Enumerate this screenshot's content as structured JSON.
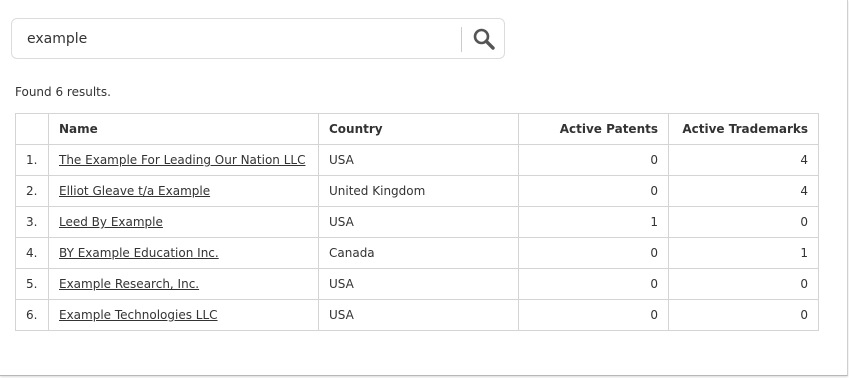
{
  "search": {
    "value": "example",
    "placeholder": ""
  },
  "results_summary": "Found 6 results.",
  "table": {
    "headers": {
      "index": "",
      "name": "Name",
      "country": "Country",
      "patents": "Active Patents",
      "trademarks": "Active Trademarks"
    },
    "rows": [
      {
        "index": "1.",
        "name": "The Example For Leading Our Nation LLC",
        "country": "USA",
        "patents": "0",
        "trademarks": "4"
      },
      {
        "index": "2.",
        "name": "Elliot Gleave t/a Example",
        "country": "United Kingdom",
        "patents": "0",
        "trademarks": "4"
      },
      {
        "index": "3.",
        "name": "Leed By Example",
        "country": "USA",
        "patents": "1",
        "trademarks": "0"
      },
      {
        "index": "4.",
        "name": "BY Example Education Inc.",
        "country": "Canada",
        "patents": "0",
        "trademarks": "1"
      },
      {
        "index": "5.",
        "name": "Example Research, Inc.",
        "country": "USA",
        "patents": "0",
        "trademarks": "0"
      },
      {
        "index": "6.",
        "name": "Example Technologies LLC",
        "country": "USA",
        "patents": "0",
        "trademarks": "0"
      }
    ]
  },
  "icons": {
    "search": "search-icon"
  },
  "colors": {
    "text": "#333333",
    "border": "#d4d4d4",
    "icon": "#555555"
  }
}
